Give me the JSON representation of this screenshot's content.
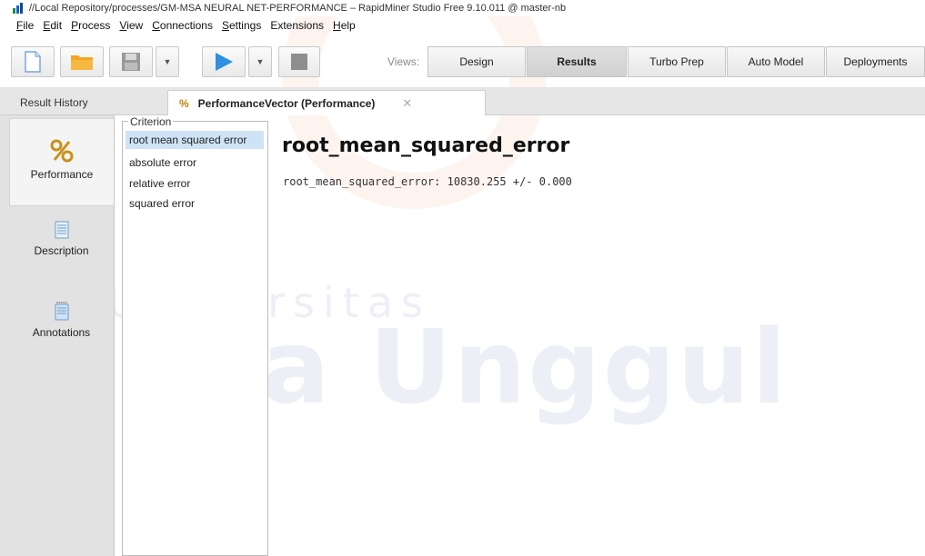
{
  "window": {
    "title": "//Local Repository/processes/GM-MSA NEURAL NET-PERFORMANCE – RapidMiner Studio Free 9.10.011 @ master-nb"
  },
  "menu": [
    {
      "mnemonic": "F",
      "rest": "ile"
    },
    {
      "mnemonic": "E",
      "rest": "dit"
    },
    {
      "mnemonic": "P",
      "rest": "rocess"
    },
    {
      "mnemonic": "V",
      "rest": "iew"
    },
    {
      "mnemonic": "C",
      "rest": "onnections"
    },
    {
      "mnemonic": "S",
      "rest": "ettings"
    },
    {
      "mnemonic": "",
      "rest": "Extensions"
    },
    {
      "mnemonic": "H",
      "rest": "elp"
    }
  ],
  "toolbar": {
    "views_label": "Views:",
    "views": [
      {
        "label": "Design",
        "active": false
      },
      {
        "label": "Results",
        "active": true
      },
      {
        "label": "Turbo Prep",
        "active": false
      },
      {
        "label": "Auto Model",
        "active": false
      },
      {
        "label": "Deployments",
        "active": false
      }
    ]
  },
  "tabs": {
    "history_label": "Result History",
    "active_label": "PerformanceVector (Performance)",
    "close_glyph": "✕"
  },
  "leftnav": [
    {
      "label": "Performance",
      "icon": "percent-icon",
      "active": true
    },
    {
      "label": "Description",
      "icon": "document-icon",
      "active": false
    },
    {
      "label": "Annotations",
      "icon": "notepad-icon",
      "active": false
    }
  ],
  "criterion": {
    "legend": "Criterion",
    "items": [
      {
        "label": "root mean squared error",
        "selected": true
      },
      {
        "label": "absolute error",
        "selected": false
      },
      {
        "label": "relative error",
        "selected": false
      },
      {
        "label": "squared error",
        "selected": false
      }
    ]
  },
  "result": {
    "title": "root_mean_squared_error",
    "line": "root_mean_squared_error: 10830.255 +/- 0.000"
  },
  "watermark": {
    "line1": "Universitas",
    "line2": "Esa Unggul"
  },
  "colors": {
    "selection": "#cfe3f7",
    "play_blue": "#2f8fe0",
    "folder_orange": "#f4a623"
  }
}
